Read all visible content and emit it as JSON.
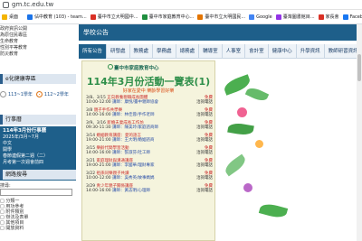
{
  "browser": {
    "url": "gm.tc.edu.tw",
    "bookmarks": [
      {
        "label": "桌面",
        "color": "#f4b400"
      },
      {
        "label": "佔中教育 (103) - team...",
        "color": "#1a73e8"
      },
      {
        "label": "臺中市立大明國中...",
        "color": "#d93025"
      },
      {
        "label": "臺中市家庭教育中心...",
        "color": "#1e8e3e"
      },
      {
        "label": "臺中市立大明國民...",
        "color": "#e37400"
      },
      {
        "label": "Google",
        "color": "#4285f4"
      },
      {
        "label": "臺灣圖書館目...",
        "color": "#9334e6"
      },
      {
        "label": "家長會",
        "color": "#d93025"
      },
      {
        "label": "Facebook",
        "color": "#1877f2"
      },
      {
        "label": "(7) youtube: ka) t...",
        "color": "#ff0000"
      },
      {
        "label": "臺中市立信義國民...",
        "color": "#1e8e3e"
      },
      {
        "label": "KatoVR...",
        "color": "#e37400"
      }
    ]
  },
  "sidebar": {
    "links": [
      "政府資訊公開",
      "為原住民專區",
      "生命教育",
      "性別平等教育",
      "防災教育"
    ],
    "health_heading": "e化健康專區",
    "radio_options": [
      {
        "label": "113~1學年",
        "selected": false
      },
      {
        "label": "112~2學年",
        "selected": true
      }
    ],
    "calendar_heading": "行事曆",
    "calendar_lines": [
      "114年3月份行事曆",
      "2025年/3月~7月",
      "中文",
      "開學",
      "春節連假第二週（二）",
      "月考第一次週會前四"
    ],
    "search_heading": "網路搜尋",
    "search_label": "搜尋:",
    "checkboxes": [
      "分類一",
      "用功參考",
      "附件類別",
      "辦法及表單",
      "其他項目",
      "開放資料"
    ]
  },
  "main": {
    "title": "學校公告",
    "tabs": [
      {
        "label": "所有公告",
        "active": true
      },
      {
        "label": "研發處",
        "active": false
      },
      {
        "label": "教務處",
        "active": false
      },
      {
        "label": "學務處",
        "active": false
      },
      {
        "label": "總務處",
        "active": false
      },
      {
        "label": "輔導室",
        "active": false
      },
      {
        "label": "人事室",
        "active": false
      },
      {
        "label": "會計室",
        "active": false
      },
      {
        "label": "健康中心",
        "active": false
      },
      {
        "label": "升學資訊",
        "active": false
      },
      {
        "label": "教師研習資訊",
        "active": false
      }
    ],
    "poster": {
      "brand": "臺中市家庭教育中心",
      "title": "114年3月份活動一覽表(1)",
      "subtitle": "好家在愛中 樂齡學習好樂",
      "events": [
        {
          "date": "3/8、3/15",
          "time": "10:00-12:00",
          "name": "正向教養親職成長團體",
          "speaker": "講師：康悅/臺中親師協會",
          "cost": "免費",
          "contact": "洽詢電話"
        },
        {
          "date": "3/8",
          "time": "14:00-16:00",
          "name": "親子手作共學樂",
          "speaker": "講師：林佳蓉/手作老師",
          "cost": "免費",
          "contact": "洽詢電話"
        },
        {
          "date": "3/9、3/16",
          "time": "09:30-11:30",
          "name": "新婚夫妻成長工作坊",
          "speaker": "講師：陳美玲/家庭諮商師",
          "cost": "免費",
          "contact": "洽詢電話"
        },
        {
          "date": "3/14",
          "time": "19:00-21:00",
          "name": "婚姻教育講座：愛的語言",
          "speaker": "講師：王大明/婚姻諮商",
          "cost": "免費",
          "contact": "洽詢電話"
        },
        {
          "date": "3/15",
          "time": "14:00-16:00",
          "name": "樂齡代間學習活動",
          "speaker": "講師：張淑芬/社工師",
          "cost": "免費",
          "contact": "洽詢電話"
        },
        {
          "date": "3/21",
          "time": "19:00-21:00",
          "name": "家庭理財與溝通講座",
          "speaker": "講師：李國華/理財專家",
          "cost": "免費",
          "contact": "洽詢電話"
        },
        {
          "date": "3/22",
          "time": "10:00-12:00",
          "name": "祖孫同樂親子共讀",
          "speaker": "講師：吳秀英/故事媽媽",
          "cost": "免費",
          "contact": "洽詢電話"
        },
        {
          "date": "3/29",
          "time": "14:00-16:00",
          "name": "青少年親子關係講座",
          "speaker": "講師：黃志明/心理師",
          "cost": "免費",
          "contact": "洽詢電話"
        }
      ]
    }
  },
  "colors": {
    "primary": "#1e5f8a",
    "accent": "#e07a1f",
    "poster_bg": "#f5f4dd",
    "poster_title": "#2f8f4a"
  }
}
